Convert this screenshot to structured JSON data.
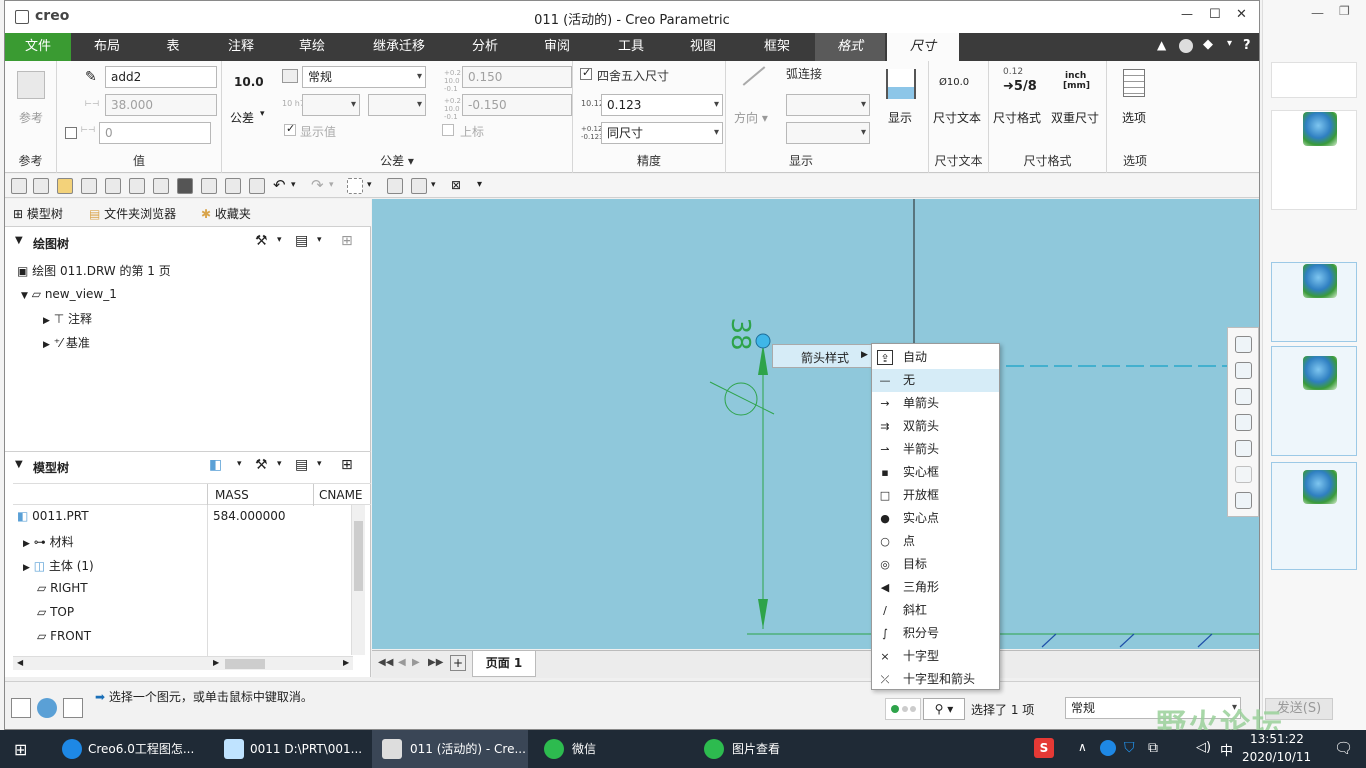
{
  "window": {
    "logo": "creo",
    "title": "011 (活动的) - Creo Parametric",
    "controls": [
      "—",
      "☐",
      "✕"
    ]
  },
  "ribbon_tabs": [
    {
      "label": "文件"
    },
    {
      "label": "布局"
    },
    {
      "label": "表"
    },
    {
      "label": "注释"
    },
    {
      "label": "草绘"
    },
    {
      "label": "继承迁移"
    },
    {
      "label": "分析"
    },
    {
      "label": "审阅"
    },
    {
      "label": "工具"
    },
    {
      "label": "视图"
    },
    {
      "label": "框架"
    },
    {
      "label": "格式"
    },
    {
      "label": "尺寸"
    }
  ],
  "ribbon": {
    "ref": {
      "button": "参考",
      "group": "参考"
    },
    "value": {
      "name": "add2",
      "nominal": "38.000",
      "override": "0",
      "group": "值"
    },
    "tolerance": {
      "button_value": "10.0",
      "button": "公差",
      "mode": "常规",
      "upper": "0.150",
      "lower": "-0.150",
      "show_value": "显示值",
      "superscript": "上标",
      "group": "公差"
    },
    "precision": {
      "round_label": "四舍五入尺寸",
      "decimals": "0.123",
      "tol_decimals": "同尺寸",
      "group": "精度"
    },
    "display": {
      "direction": "方向",
      "arc": "弧连接",
      "show": "显示",
      "group": "显示"
    },
    "dim_text": {
      "button": "尺寸文本",
      "icon_text": "Ø10.0",
      "group": "尺寸文本"
    },
    "dim_format": {
      "format_btn": "尺寸格式",
      "dual_btn": "双重尺寸",
      "frac_top": "0.12",
      "frac": "5/8",
      "inch": "inch",
      "mm": "[mm]",
      "group": "尺寸格式"
    },
    "options": {
      "button": "选项",
      "group": "选项"
    }
  },
  "left_tabs": [
    "模型树",
    "文件夹浏览器",
    "收藏夹"
  ],
  "drawing_tree": {
    "header": "绘图树",
    "items": [
      "绘图 011.DRW 的第 1 页",
      "new_view_1",
      "注释",
      "基准"
    ]
  },
  "model_tree": {
    "header": "模型树",
    "columns": [
      "MASS",
      "CNAME"
    ],
    "rows": [
      {
        "name": "0011.PRT",
        "mass": "584.000000"
      },
      {
        "name": "材料",
        "mass": ""
      },
      {
        "name": "主体 (1)",
        "mass": ""
      },
      {
        "name": "RIGHT",
        "mass": ""
      },
      {
        "name": "TOP",
        "mass": ""
      },
      {
        "name": "FRONT",
        "mass": ""
      }
    ]
  },
  "canvas": {
    "dimension_text": "38",
    "color_dim": "#2ea34a",
    "bg": "#8fc8db"
  },
  "context_menu": {
    "parent": "箭头样式",
    "items": [
      "自动",
      "无",
      "单箭头",
      "双箭头",
      "半箭头",
      "实心框",
      "开放框",
      "实心点",
      "点",
      "目标",
      "三角形",
      "斜杠",
      "积分号",
      "十字型",
      "十字型和箭头"
    ],
    "icons": [
      "⇪",
      "—",
      "→",
      "⇉",
      "⇀",
      "▪",
      "□",
      "●",
      "○",
      "◎",
      "◀",
      "∕",
      "∫",
      "×",
      "⤫"
    ],
    "highlighted": "无"
  },
  "page_bar": {
    "page": "页面 1"
  },
  "status": {
    "message": "选择一个图元，或单击鼠标中键取消。",
    "selected": "选择了 1 项",
    "filter": "常规"
  },
  "right_app": {
    "send_button": "发送(S)"
  },
  "watermark": "野火论坛",
  "taskbar": {
    "items": [
      "Creo6.0工程图怎...",
      "0011 D:\\PRT\\001...",
      "011 (活动的) - Cre...",
      "微信",
      "图片查看"
    ],
    "time": "13:51:22",
    "date": "2020/10/11"
  }
}
